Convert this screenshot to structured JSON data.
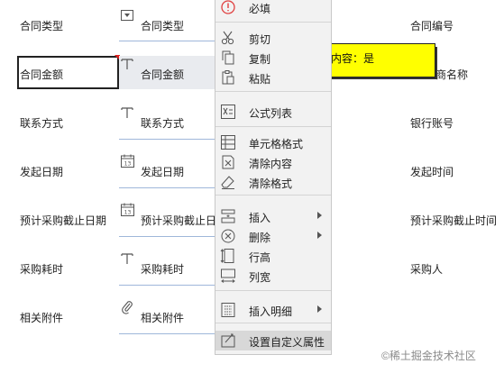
{
  "form": {
    "left_labels": [
      "合同类型",
      "合同金额",
      "联系方式",
      "发起日期",
      "预计采购截止日期",
      "采购耗时",
      "相关附件"
    ],
    "field_labels": [
      "合同类型",
      "合同金额",
      "联系方式",
      "发起日期",
      "预计采购截止日期",
      "采购耗时",
      "相关附件"
    ],
    "right_labels": [
      "合同编号",
      "商名称",
      "银行账号",
      "发起时间",
      "预计采购截止时间",
      "采购人"
    ]
  },
  "field_icons": [
    "dropdown-icon",
    "text-field-icon",
    "text-field-icon",
    "calendar-icon",
    "calendar-icon",
    "text-field-icon",
    "paperclip-icon"
  ],
  "tooltip": {
    "text": "内容：是"
  },
  "menu": {
    "items": [
      {
        "label": "必填",
        "icon": "alert-circle-icon"
      },
      {
        "label": "剪切",
        "icon": "scissors-icon"
      },
      {
        "label": "复制",
        "icon": "copy-icon"
      },
      {
        "label": "粘贴",
        "icon": "paste-icon"
      },
      {
        "label": "公式列表",
        "icon": "formula-icon"
      },
      {
        "label": "单元格格式",
        "icon": "cell-format-icon"
      },
      {
        "label": "清除内容",
        "icon": "clear-content-icon"
      },
      {
        "label": "清除格式",
        "icon": "eraser-icon"
      },
      {
        "label": "插入",
        "icon": "insert-icon"
      },
      {
        "label": "删除",
        "icon": "delete-icon"
      },
      {
        "label": "行高",
        "icon": "row-height-icon"
      },
      {
        "label": "列宽",
        "icon": "column-width-icon"
      },
      {
        "label": "插入明细",
        "icon": "insert-detail-icon"
      },
      {
        "label": "设置自定义属性",
        "icon": "custom-property-icon"
      }
    ]
  },
  "calendar_icon_text": "13",
  "watermark": "©稀土掘金技术社区",
  "colors": {
    "underline": "#9fb7da",
    "tooltip_bg": "#ffff00",
    "required_corner": "#e02020",
    "menu_bg": "#f2f2f2"
  }
}
